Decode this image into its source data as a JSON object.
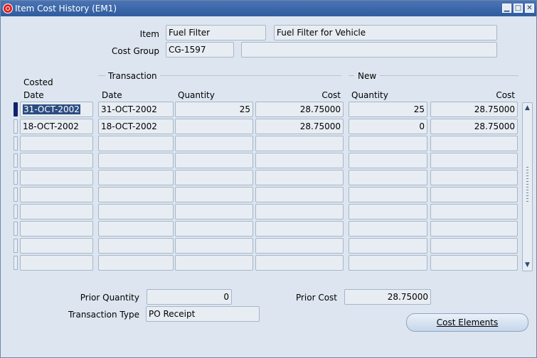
{
  "window": {
    "title": "Item Cost History (EM1)"
  },
  "header": {
    "item_label": "Item",
    "item_value": "Fuel Filter",
    "item_description": "Fuel Filter for Vehicle",
    "cost_group_label": "Cost Group",
    "cost_group_value": "CG-1597",
    "cost_group_description": ""
  },
  "grid": {
    "group_transaction": "Transaction",
    "group_new": "New",
    "col_costed_line1": "Costed",
    "col_costed_line2": "Date",
    "col_txn_date": "Date",
    "col_txn_quantity": "Quantity",
    "col_txn_cost": "Cost",
    "col_new_quantity": "Quantity",
    "col_new_cost": "Cost",
    "rows": [
      {
        "costed_date": "31-OCT-2002",
        "txn_date": "31-OCT-2002",
        "txn_quantity": "25",
        "txn_cost": "28.75000",
        "new_quantity": "25",
        "new_cost": "28.75000"
      },
      {
        "costed_date": "18-OCT-2002",
        "txn_date": "18-OCT-2002",
        "txn_quantity": "",
        "txn_cost": "28.75000",
        "new_quantity": "0",
        "new_cost": "28.75000"
      },
      {
        "costed_date": "",
        "txn_date": "",
        "txn_quantity": "",
        "txn_cost": "",
        "new_quantity": "",
        "new_cost": ""
      },
      {
        "costed_date": "",
        "txn_date": "",
        "txn_quantity": "",
        "txn_cost": "",
        "new_quantity": "",
        "new_cost": ""
      },
      {
        "costed_date": "",
        "txn_date": "",
        "txn_quantity": "",
        "txn_cost": "",
        "new_quantity": "",
        "new_cost": ""
      },
      {
        "costed_date": "",
        "txn_date": "",
        "txn_quantity": "",
        "txn_cost": "",
        "new_quantity": "",
        "new_cost": ""
      },
      {
        "costed_date": "",
        "txn_date": "",
        "txn_quantity": "",
        "txn_cost": "",
        "new_quantity": "",
        "new_cost": ""
      },
      {
        "costed_date": "",
        "txn_date": "",
        "txn_quantity": "",
        "txn_cost": "",
        "new_quantity": "",
        "new_cost": ""
      },
      {
        "costed_date": "",
        "txn_date": "",
        "txn_quantity": "",
        "txn_cost": "",
        "new_quantity": "",
        "new_cost": ""
      },
      {
        "costed_date": "",
        "txn_date": "",
        "txn_quantity": "",
        "txn_cost": "",
        "new_quantity": "",
        "new_cost": ""
      }
    ]
  },
  "footer": {
    "prior_quantity_label": "Prior Quantity",
    "prior_quantity_value": "0",
    "prior_cost_label": "Prior Cost",
    "prior_cost_value": "28.75000",
    "transaction_type_label": "Transaction Type",
    "transaction_type_value": "PO Receipt",
    "cost_elements_button": "Cost Elements"
  },
  "icons": {
    "app": "oracle-icon",
    "minimize": "minimize-icon",
    "maximize": "maximize-icon",
    "close": "close-icon",
    "scroll_up": "scroll-up-icon",
    "scroll_down": "scroll-down-icon"
  }
}
